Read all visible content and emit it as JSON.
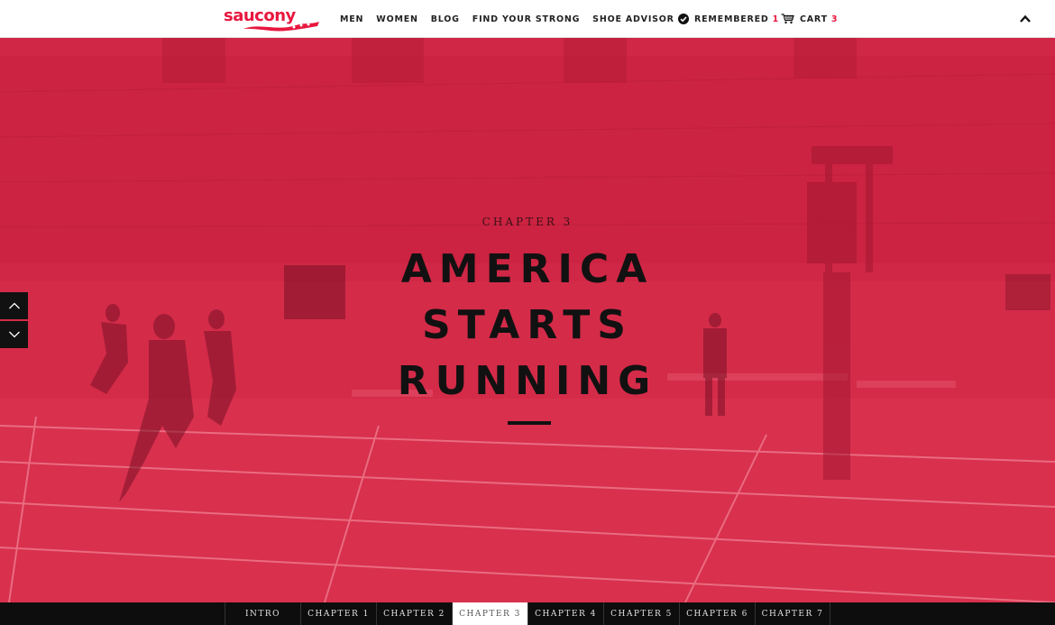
{
  "brand": {
    "name": "saucony",
    "color": "#e8173f"
  },
  "nav": {
    "items": [
      "MEN",
      "WOMEN",
      "BLOG",
      "FIND YOUR STRONG",
      "SHOE ADVISOR"
    ]
  },
  "utility": {
    "remembered_label": "REMEMBERED",
    "remembered_count": "1",
    "cart_label": "CART",
    "cart_count": "3"
  },
  "hero": {
    "chapter_label": "CHAPTER 3",
    "headline_lines": [
      "AMERICA",
      "STARTS",
      "RUNNING"
    ],
    "overlay_color": "#d62a49"
  },
  "chapters": {
    "tabs": [
      "INTRO",
      "CHAPTER 1",
      "CHAPTER 2",
      "CHAPTER 3",
      "CHAPTER 4",
      "CHAPTER 5",
      "CHAPTER 6",
      "CHAPTER 7"
    ],
    "active": "CHAPTER 3"
  },
  "icons": {
    "remembered": "check-circle-icon",
    "cart": "cart-icon",
    "collapse": "chevron-up-icon",
    "prev": "chevron-up-icon",
    "next": "chevron-down-icon"
  }
}
